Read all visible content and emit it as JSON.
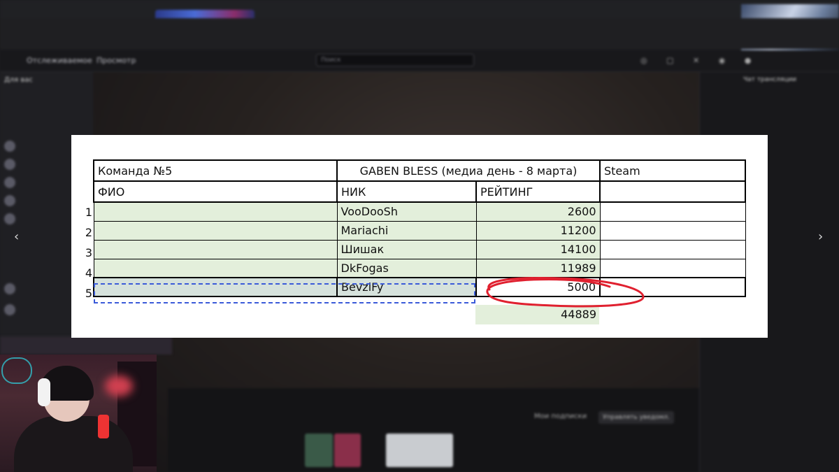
{
  "stream_ui": {
    "header_links": [
      "Отслеживаемое",
      "Просмотр"
    ],
    "search_placeholder": "Поиск",
    "left_panel_title": "Для вас",
    "chat_title": "Чат трансляции",
    "subscribe_label": "Мои подписки",
    "notify_label": "Управлять уведомл."
  },
  "sheet": {
    "team": "Команда №5",
    "event": "GABEN BLESS (медиа день - 8 марта)",
    "platform": "Steam",
    "headers": {
      "name": "ФИО",
      "nick": "НИК",
      "rating": "РЕЙТИНГ"
    },
    "rows": [
      {
        "num": "1",
        "name": "",
        "nick": "VooDooSh",
        "rating": "2600"
      },
      {
        "num": "2",
        "name": "",
        "nick": "Mariachi",
        "rating": "11200"
      },
      {
        "num": "3",
        "name": "",
        "nick": "Шишак",
        "rating": "14100"
      },
      {
        "num": "4",
        "name": "",
        "nick": "DkFogas",
        "rating": "11989"
      },
      {
        "num": "5",
        "name": "",
        "nick": "BevziFy",
        "rating": "5000"
      }
    ],
    "total": "44889",
    "highlight_color": "#e0202f",
    "selection_color": "#3b5bd9"
  }
}
